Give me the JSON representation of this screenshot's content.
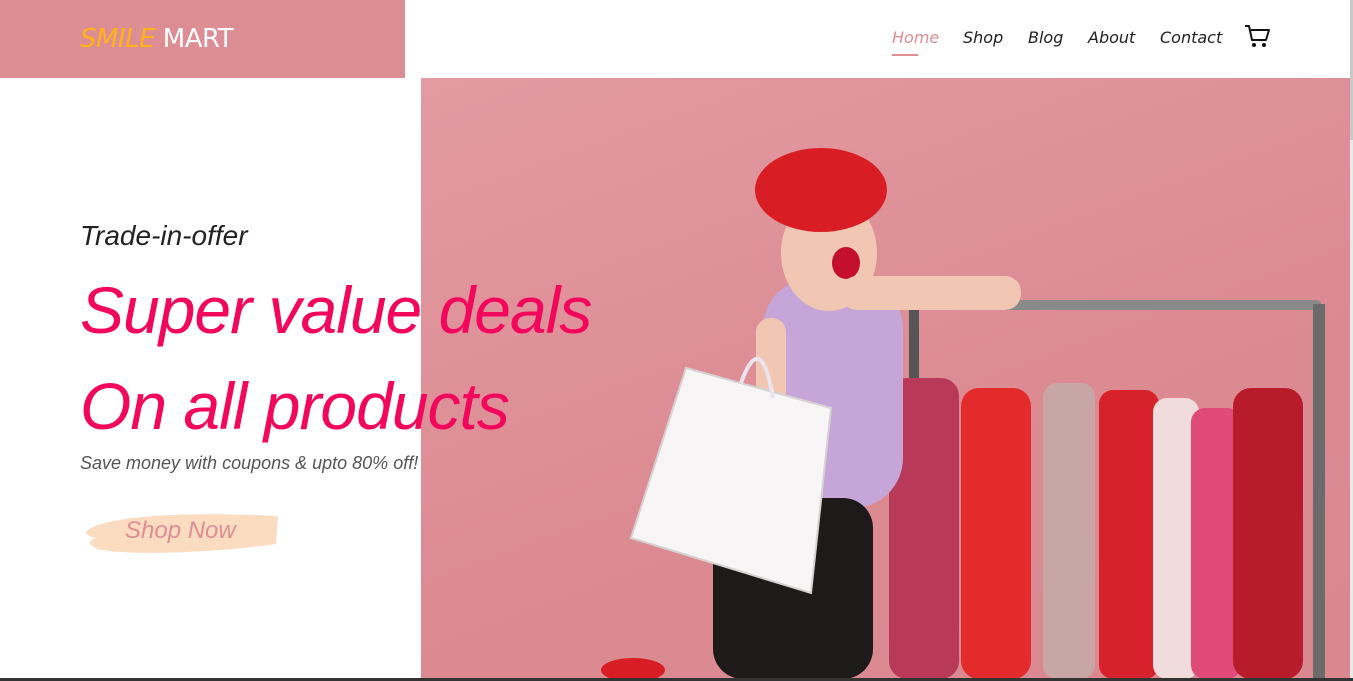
{
  "brand": {
    "part1": "SMILE",
    "part2": "MART",
    "accent": "#ffb21a",
    "bg": "#dd8d94"
  },
  "nav": {
    "items": [
      {
        "label": "Home",
        "active": true
      },
      {
        "label": "Shop",
        "active": false
      },
      {
        "label": "Blog",
        "active": false
      },
      {
        "label": "About",
        "active": false
      },
      {
        "label": "Contact",
        "active": false
      }
    ],
    "cart_icon": "shopping-cart-icon"
  },
  "hero": {
    "eyebrow": "Trade-in-offer",
    "headline_line1": "Super value deals",
    "headline_line2": "On all products",
    "subtitle": "Save money with coupons & upto 80% off!",
    "cta_label": "Shop Now",
    "headline_color": "#f2075d",
    "image": "woman-shopping-with-clothes-rack"
  }
}
